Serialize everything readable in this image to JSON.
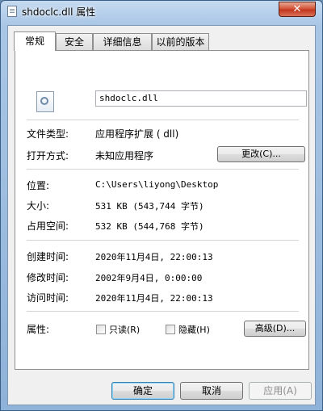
{
  "window": {
    "title": "shdoclc.dll 属性",
    "close_label": "✕"
  },
  "tabs": [
    {
      "label": "常规"
    },
    {
      "label": "安全"
    },
    {
      "label": "详细信息"
    },
    {
      "label": "以前的版本"
    }
  ],
  "general": {
    "file_name": "shdoclc.dll",
    "type_label": "文件类型:",
    "type_value": "应用程序扩展 ( dll)",
    "opens_label": "打开方式:",
    "opens_value": "未知应用程序",
    "change_button": "更改(C)...",
    "location_label": "位置:",
    "location_value": "C:\\Users\\liyong\\Desktop",
    "size_label": "大小:",
    "size_value": "531 KB (543,744 字节)",
    "disk_label": "占用空间:",
    "disk_value": "532 KB (544,768 字节)",
    "created_label": "创建时间:",
    "created_value": "2020年11月4日, 22:00:13",
    "modified_label": "修改时间:",
    "modified_value": "2002年9月4日, 0:00:00",
    "accessed_label": "访问时间:",
    "accessed_value": "2020年11月4日, 22:00:13",
    "attributes_label": "属性:",
    "readonly_label": "只读(R)",
    "hidden_label": "隐藏(H)",
    "advanced_button": "高级(D)..."
  },
  "buttons": {
    "ok": "确定",
    "cancel": "取消",
    "apply": "应用(A)"
  }
}
